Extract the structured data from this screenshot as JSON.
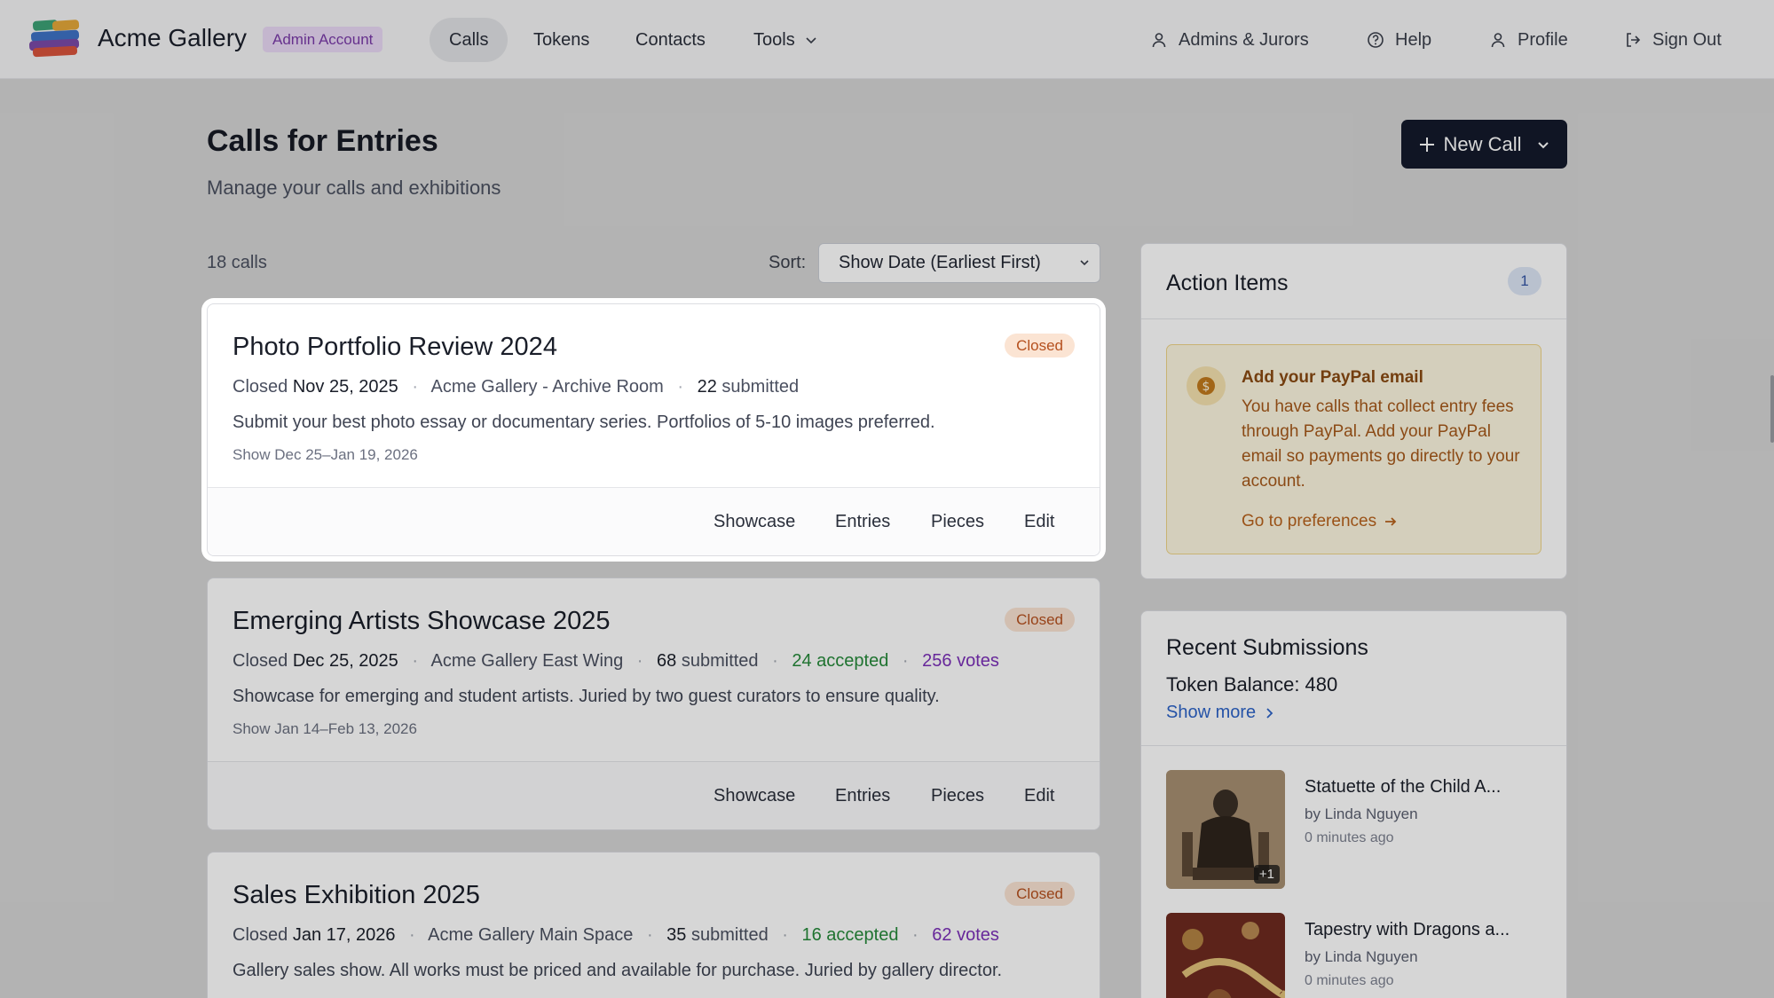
{
  "header": {
    "brand": "Acme Gallery",
    "admin_badge": "Admin Account",
    "nav": [
      {
        "label": "Calls"
      },
      {
        "label": "Tokens"
      },
      {
        "label": "Contacts"
      },
      {
        "label": "Tools"
      }
    ],
    "right_nav": [
      {
        "label": "Admins & Jurors",
        "icon": "user-icon"
      },
      {
        "label": "Help",
        "icon": "help-circle-icon"
      },
      {
        "label": "Profile",
        "icon": "user-icon"
      },
      {
        "label": "Sign Out",
        "icon": "sign-out-icon"
      }
    ]
  },
  "page": {
    "title": "Calls for Entries",
    "subtitle": "Manage your calls and exhibitions",
    "new_call_label": "New Call",
    "calls_count": "18 calls",
    "sort_label": "Sort:",
    "sort_value": "Show Date (Earliest First)"
  },
  "calls": [
    {
      "title": "Photo Portfolio Review 2024",
      "status": "Closed",
      "closed_prefix": "Closed",
      "closed_date": "Nov 25, 2025",
      "venue": "Acme Gallery - Archive Room",
      "submitted_count": "22",
      "submitted_label": "submitted",
      "description": "Submit your best photo essay or documentary series. Portfolios of 5-10 images preferred.",
      "show_dates": "Show Dec 25–Jan 19, 2026"
    },
    {
      "title": "Emerging Artists Showcase 2025",
      "status": "Closed",
      "closed_prefix": "Closed",
      "closed_date": "Dec 25, 2025",
      "venue": "Acme Gallery East Wing",
      "submitted_count": "68",
      "submitted_label": "submitted",
      "accepted": "24 accepted",
      "votes": "256 votes",
      "description": "Showcase for emerging and student artists. Juried by two guest curators to ensure quality.",
      "show_dates": "Show Jan 14–Feb 13, 2026"
    },
    {
      "title": "Sales Exhibition 2025",
      "status": "Closed",
      "closed_prefix": "Closed",
      "closed_date": "Jan 17, 2026",
      "venue": "Acme Gallery Main Space",
      "submitted_count": "35",
      "submitted_label": "submitted",
      "accepted": "16 accepted",
      "votes": "62 votes",
      "description": "Gallery sales show. All works must be priced and available for purchase. Juried by gallery director."
    }
  ],
  "card_actions": {
    "showcase": "Showcase",
    "entries": "Entries",
    "pieces": "Pieces",
    "edit": "Edit"
  },
  "action_items": {
    "title": "Action Items",
    "count": "1",
    "paypal": {
      "title": "Add your PayPal email",
      "text": "You have calls that collect entry fees through PayPal. Add your PayPal email so payments go directly to your account.",
      "link": "Go to preferences"
    }
  },
  "recent_submissions": {
    "title": "Recent Submissions",
    "token_balance": "Token Balance: 480",
    "show_more": "Show more",
    "items": [
      {
        "title": "Statuette of the Child A...",
        "by": "by Linda Nguyen",
        "time": "0 minutes ago",
        "extra": "+1"
      },
      {
        "title": "Tapestry with Dragons a...",
        "by": "by Linda Nguyen",
        "time": "0 minutes ago"
      }
    ]
  },
  "colors": {
    "primary_button": "#141a2b",
    "closed_badge_bg": "#fbe4d3",
    "closed_badge_text": "#b5501e",
    "accepted": "#258a3a",
    "votes": "#7b2fb8",
    "link": "#2d63c8"
  }
}
